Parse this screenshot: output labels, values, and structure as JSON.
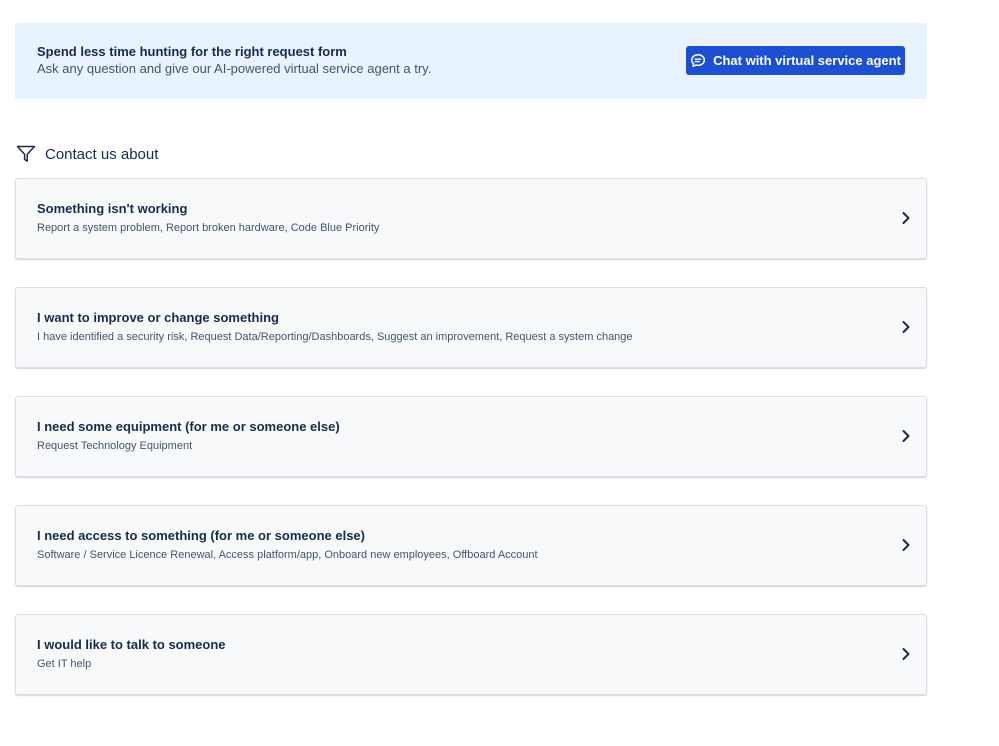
{
  "banner": {
    "title": "Spend less time hunting for the right request form",
    "description": "Ask any question and give our AI-powered virtual service agent a try.",
    "button_label": "Chat with virtual service agent"
  },
  "section": {
    "title": "Contact us about"
  },
  "cards": [
    {
      "title": "Something isn't working",
      "description": "Report a system problem, Report broken hardware, Code Blue Priority"
    },
    {
      "title": "I want to improve or change something",
      "description": "I have identified a security risk, Request Data/Reporting/Dashboards, Suggest an improvement, Request a system change"
    },
    {
      "title": "I need some equipment (for me or someone else)",
      "description": "Request Technology Equipment"
    },
    {
      "title": "I need access to something (for me or someone else)",
      "description": "Software / Service Licence Renewal, Access platform/app, Onboard new employees, Offboard Account"
    },
    {
      "title": "I would like to talk to someone",
      "description": "Get IT help"
    }
  ],
  "icons": {
    "chat_button": "chat-bubble-icon",
    "section": "filter-icon",
    "card_action": "chevron-right-icon"
  },
  "colors": {
    "banner_bg": "#e9f2ff",
    "primary_button": "#1d4fd1",
    "card_bg": "#f8f9fb",
    "text": "#172b4d"
  }
}
